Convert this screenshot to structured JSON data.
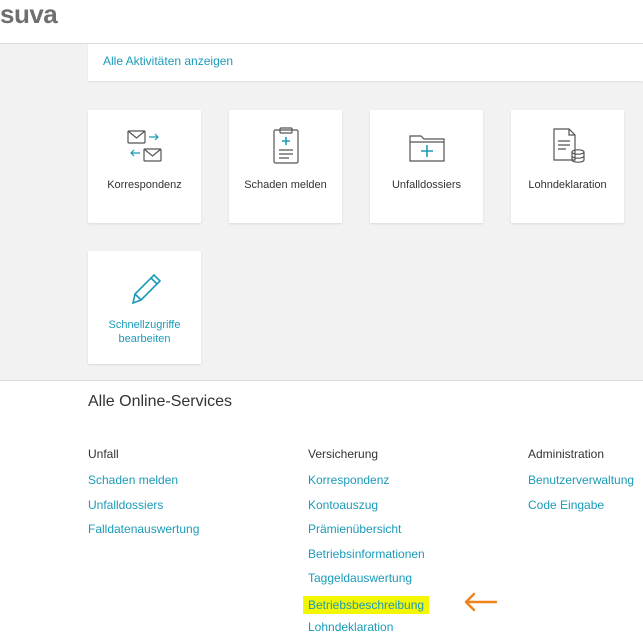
{
  "header": {
    "logo_text": "suva"
  },
  "activities": {
    "link_label": "Alle Aktivitäten anzeigen"
  },
  "tiles": [
    {
      "label": "Korrespondenz",
      "icon": "mail-exchange-icon"
    },
    {
      "label": "Schaden melden",
      "icon": "clipboard-medical-icon"
    },
    {
      "label": "Unfalldossiers",
      "icon": "folder-medical-icon"
    },
    {
      "label": "Lohndeklaration",
      "icon": "document-coins-icon"
    }
  ],
  "edit_tile": {
    "label_line1": "Schnellzugriffe",
    "label_line2": "bearbeiten",
    "icon": "pencil-icon"
  },
  "services": {
    "title": "Alle Online-Services",
    "columns": [
      {
        "heading": "Unfall",
        "links": [
          "Schaden melden",
          "Unfalldossiers",
          "Falldatenauswertung"
        ]
      },
      {
        "heading": "Versicherung",
        "links": [
          "Korrespondenz",
          "Kontoauszug",
          "Prämienübersicht",
          "Betriebsinformationen",
          "Taggeldauswertung",
          "Betriebsbeschreibung",
          "Lohndeklaration"
        ]
      },
      {
        "heading": "Administration",
        "links": [
          "Benutzerverwaltung",
          "Code Eingabe"
        ]
      }
    ],
    "highlighted_link": "Betriebsbeschreibung"
  },
  "colors": {
    "accent": "#1a9bb8",
    "highlight": "#f3f700",
    "arrow": "#f0821e",
    "logo": "#6f6f6f"
  }
}
